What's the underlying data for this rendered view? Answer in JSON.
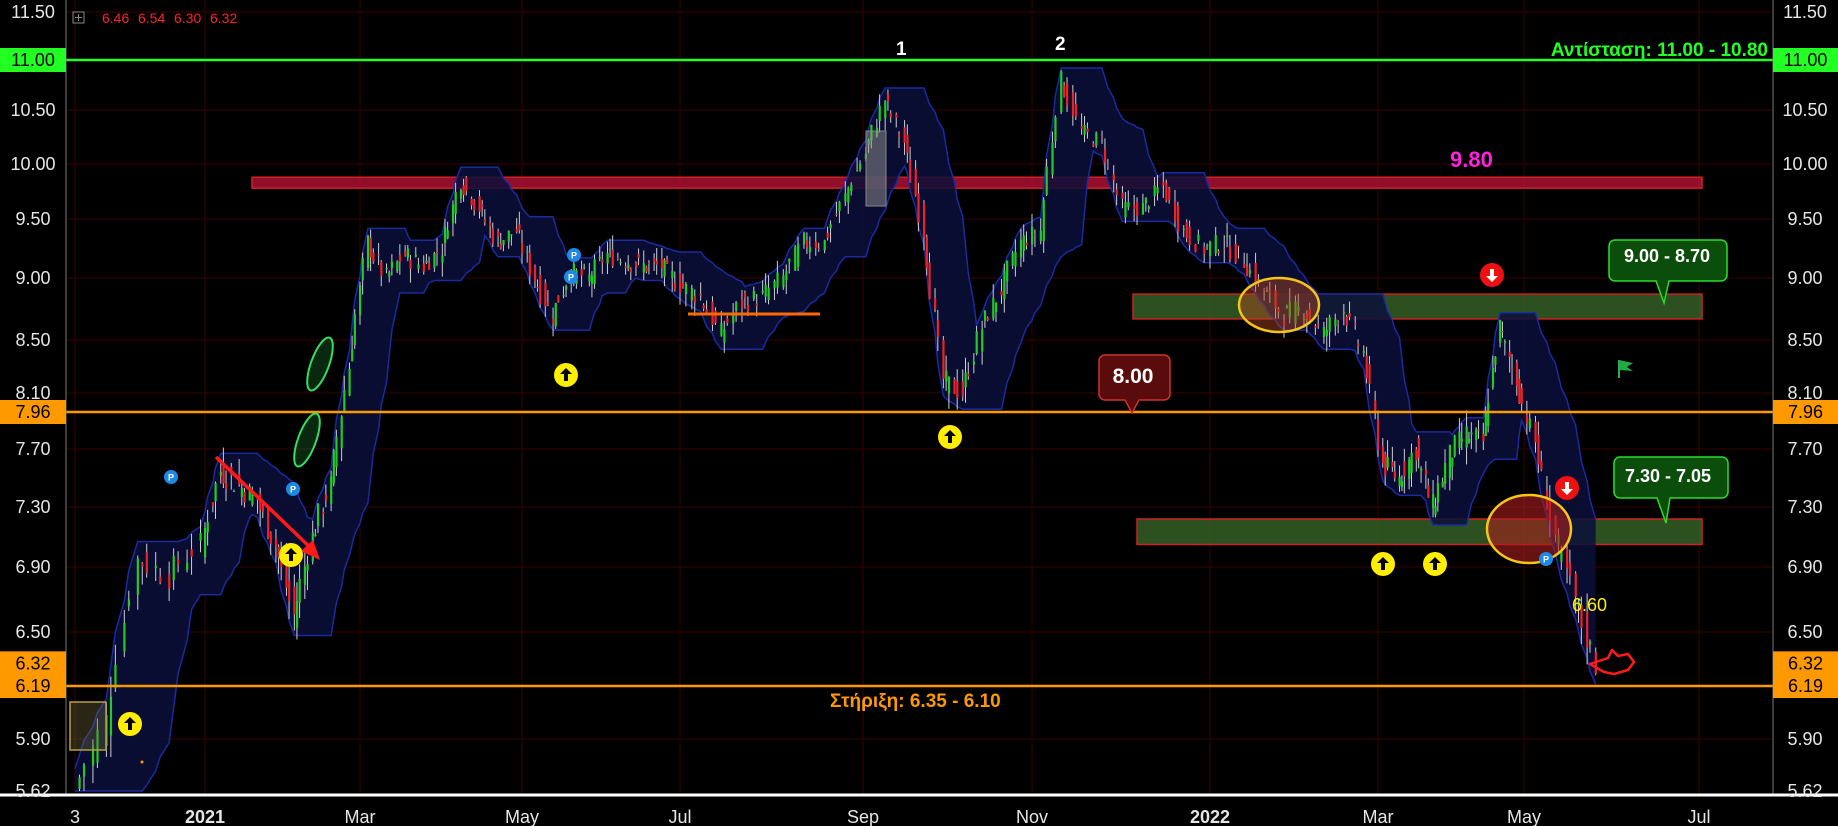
{
  "ohlc_header": {
    "open": "6.46",
    "high": "6.54",
    "low": "6.30",
    "close": "6.32"
  },
  "chart_data": {
    "type": "candlestick",
    "title": "",
    "ylim": [
      5.62,
      11.5
    ],
    "y_ticks": [
      "11.50",
      "10.50",
      "10.00",
      "9.50",
      "9.00",
      "8.50",
      "8.10",
      "7.70",
      "7.30",
      "6.90",
      "6.50",
      "5.90",
      "5.62"
    ],
    "x_labels": [
      "3",
      "2021",
      "Mar",
      "May",
      "Jul",
      "Sep",
      "Nov",
      "2022",
      "Mar",
      "May",
      "Jul"
    ],
    "bold_x_labels": [
      "2021",
      "2022"
    ],
    "horizontal_lines": [
      {
        "price": 11.0,
        "label": "11.00",
        "color": "#22ff22"
      },
      {
        "price": 7.96,
        "label": "7.96",
        "color": "#ff9900"
      },
      {
        "price": 6.19,
        "label": "6.19",
        "color": "#ff9900"
      }
    ],
    "last_price_label": "6.32",
    "zones": [
      {
        "name": "9.80-zone",
        "low": 9.78,
        "high": 9.88,
        "color": "#c2143c"
      },
      {
        "name": "9.00-8.70-zone",
        "low": 8.67,
        "high": 8.87,
        "color": "#3b6b2a"
      },
      {
        "name": "7.30-7.05-zone",
        "low": 7.05,
        "high": 7.22,
        "color": "#3b6b2a"
      }
    ],
    "annotations": {
      "resistance": "Αντίσταση: 11.00 - 10.80",
      "support": "Στήριξη: 6.35 - 6.10",
      "level_980": "9.80",
      "box_900_870": "9.00 - 8.70",
      "box_730_705": "7.30 - 7.05",
      "box_800": "8.00",
      "label_660": "6.60",
      "peak_1": "1",
      "peak_2": "2"
    },
    "colors": {
      "up": "#22cc22",
      "down": "#ee2222",
      "channel": "#1a2aa0",
      "grid": "#3a0000"
    },
    "price_series": [
      [
        "2020-12-03",
        5.62
      ],
      [
        "2020-12-10",
        6.0
      ],
      [
        "2020-12-17",
        6.95
      ],
      [
        "2020-12-24",
        6.85
      ],
      [
        "2020-12-31",
        7.05
      ],
      [
        "2021-01-07",
        7.55
      ],
      [
        "2021-01-14",
        7.45
      ],
      [
        "2021-01-21",
        7.35
      ],
      [
        "2021-01-28",
        7.05
      ],
      [
        "2021-02-04",
        6.6
      ],
      [
        "2021-02-11",
        7.1
      ],
      [
        "2021-02-18",
        7.45
      ],
      [
        "2021-02-25",
        8.3
      ],
      [
        "2021-03-04",
        9.3
      ],
      [
        "2021-03-11",
        9.0
      ],
      [
        "2021-03-18",
        9.2
      ],
      [
        "2021-03-25",
        9.1
      ],
      [
        "2021-04-01",
        9.25
      ],
      [
        "2021-04-08",
        9.85
      ],
      [
        "2021-04-15",
        9.6
      ],
      [
        "2021-04-22",
        9.3
      ],
      [
        "2021-04-29",
        9.4
      ],
      [
        "2021-05-06",
        9.0
      ],
      [
        "2021-05-13",
        8.7
      ],
      [
        "2021-05-20",
        9.05
      ],
      [
        "2021-05-27",
        9.0
      ],
      [
        "2021-06-03",
        9.2
      ],
      [
        "2021-06-10",
        9.15
      ],
      [
        "2021-06-17",
        9.1
      ],
      [
        "2021-06-24",
        9.1
      ],
      [
        "2021-07-01",
        8.95
      ],
      [
        "2021-07-08",
        8.85
      ],
      [
        "2021-07-15",
        8.55
      ],
      [
        "2021-07-22",
        8.8
      ],
      [
        "2021-07-29",
        8.85
      ],
      [
        "2021-08-05",
        9.0
      ],
      [
        "2021-08-12",
        9.3
      ],
      [
        "2021-08-19",
        9.3
      ],
      [
        "2021-08-26",
        9.7
      ],
      [
        "2021-09-02",
        10.1
      ],
      [
        "2021-09-09",
        10.6
      ],
      [
        "2021-09-16",
        10.2
      ],
      [
        "2021-09-23",
        9.4
      ],
      [
        "2021-09-30",
        8.2
      ],
      [
        "2021-10-07",
        8.1
      ],
      [
        "2021-10-14",
        8.6
      ],
      [
        "2021-10-21",
        8.9
      ],
      [
        "2021-10-28",
        9.3
      ],
      [
        "2021-11-04",
        9.4
      ],
      [
        "2021-11-11",
        10.8
      ],
      [
        "2021-11-18",
        10.3
      ],
      [
        "2021-11-25",
        10.2
      ],
      [
        "2021-12-02",
        9.6
      ],
      [
        "2021-12-09",
        9.6
      ],
      [
        "2021-12-16",
        9.8
      ],
      [
        "2021-12-23",
        9.4
      ],
      [
        "2021-12-30",
        9.25
      ],
      [
        "2022-01-06",
        9.3
      ],
      [
        "2022-01-13",
        9.15
      ],
      [
        "2022-01-20",
        8.9
      ],
      [
        "2022-01-27",
        8.7
      ],
      [
        "2022-02-03",
        8.75
      ],
      [
        "2022-02-10",
        8.55
      ],
      [
        "2022-02-17",
        8.75
      ],
      [
        "2022-02-24",
        8.4
      ],
      [
        "2022-03-03",
        7.6
      ],
      [
        "2022-03-10",
        7.5
      ],
      [
        "2022-03-17",
        7.7
      ],
      [
        "2022-03-24",
        7.3
      ],
      [
        "2022-03-31",
        7.65
      ],
      [
        "2022-04-07",
        7.8
      ],
      [
        "2022-04-14",
        7.75
      ],
      [
        "2022-04-21",
        8.6
      ],
      [
        "2022-04-28",
        8.2
      ],
      [
        "2022-05-05",
        7.75
      ],
      [
        "2022-05-12",
        7.1
      ],
      [
        "2022-05-19",
        6.7
      ],
      [
        "2022-05-26",
        6.32
      ]
    ]
  }
}
